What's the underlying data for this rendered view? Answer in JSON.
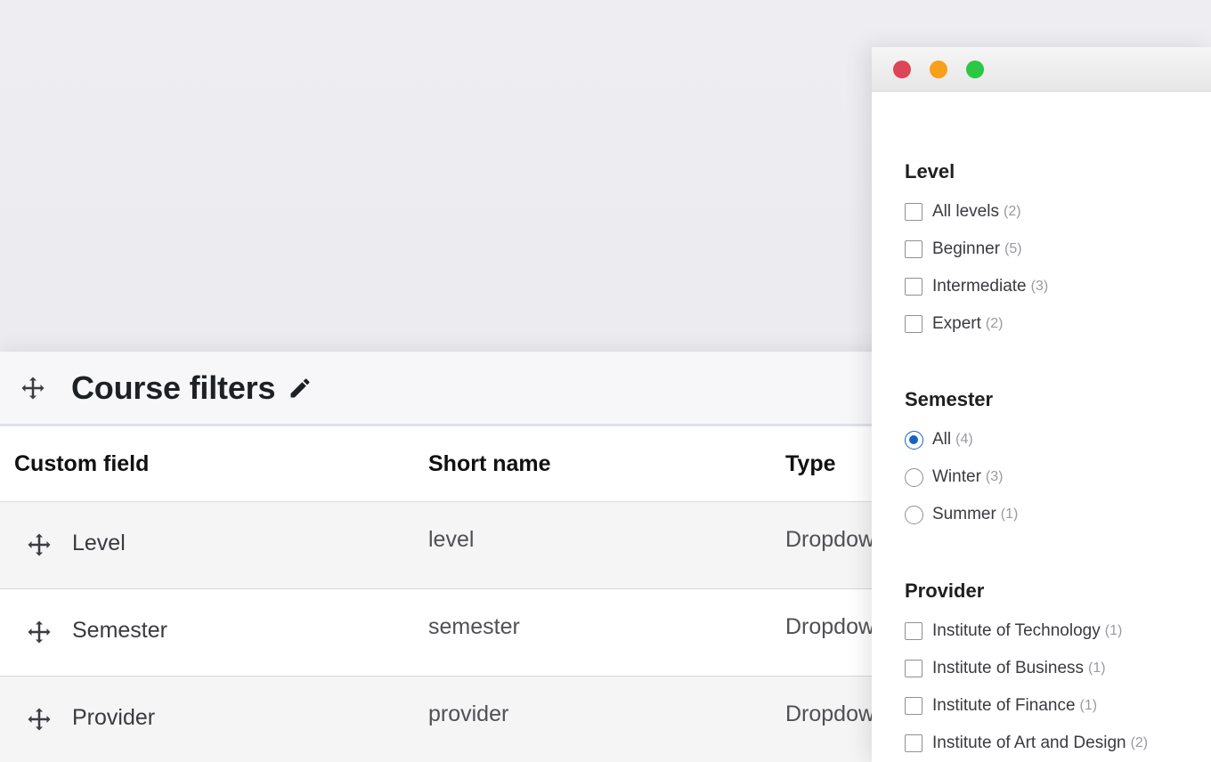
{
  "admin": {
    "title": "Course filters",
    "columns": [
      "Custom field",
      "Short name",
      "Type"
    ],
    "rows": [
      {
        "field": "Level",
        "short": "level",
        "type": "Dropdown"
      },
      {
        "field": "Semester",
        "short": "semester",
        "type": "Dropdown"
      },
      {
        "field": "Provider",
        "short": "provider",
        "type": "Dropdown"
      }
    ]
  },
  "window": {
    "controls": [
      "close",
      "minimize",
      "zoom"
    ],
    "groups": [
      {
        "title": "Level",
        "control": "checkbox",
        "options": [
          {
            "label": "All levels",
            "count": "(2)"
          },
          {
            "label": "Beginner",
            "count": "(5)"
          },
          {
            "label": "Intermediate",
            "count": "(3)"
          },
          {
            "label": "Expert",
            "count": "(2)"
          }
        ]
      },
      {
        "title": "Semester",
        "control": "radio",
        "options": [
          {
            "label": "All",
            "count": "(4)",
            "selected": true
          },
          {
            "label": "Winter",
            "count": "(3)"
          },
          {
            "label": "Summer",
            "count": "(1)"
          }
        ]
      },
      {
        "title": "Provider",
        "control": "checkbox",
        "options": [
          {
            "label": "Institute of Technology",
            "count": "(1)"
          },
          {
            "label": "Institute of Business",
            "count": "(1)"
          },
          {
            "label": "Institute of Finance",
            "count": "(1)"
          },
          {
            "label": "Institute of Art and Design",
            "count": "(2)"
          }
        ]
      }
    ]
  },
  "colors": {
    "accent": "#1565c0",
    "close": "#dc4656",
    "minimize": "#f6a01c",
    "zoom": "#2cc744"
  }
}
